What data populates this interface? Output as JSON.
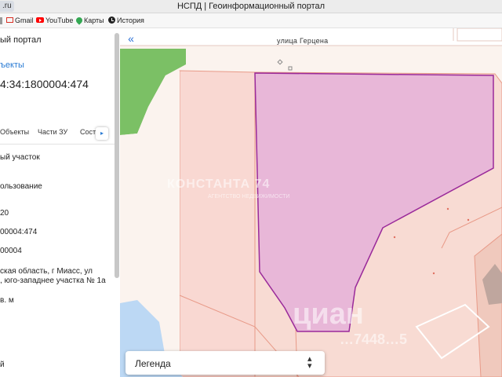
{
  "browser": {
    "url_fragment": ".ru",
    "window_title": "НСПД | Геоинформационный портал",
    "bookmarks": [
      "Gmail",
      "YouTube",
      "Карты",
      "История"
    ]
  },
  "sidebar": {
    "portal_title": "ый портал",
    "objects_link": "ъекты",
    "cadastral_number": "4:34:1800004:474",
    "tabs": [
      "Объекты",
      "Части ЗУ",
      "Сост"
    ],
    "next_tab_label": "▸",
    "fields": [
      "ый участок",
      "ользование",
      "20",
      "00004:474",
      "00004",
      "ская область, г Миасс, ул",
      ", юго-западнее участка № 1а",
      "в. м",
      "й"
    ]
  },
  "map": {
    "collapse_label": "«",
    "street_name": "улица Герцена",
    "watermark_brand": "КОНСТАНТА 74",
    "watermark_sub": "АГЕНТСТВО НЕДВИЖИМОСТИ",
    "watermark_cian": "циан",
    "watermark_phone": "…7448…5",
    "legend_label": "Легенда",
    "legend_chevron": "⌃⌄"
  },
  "colors": {
    "selected_parcel_fill": "#e8b7d8",
    "selected_parcel_stroke": "#9a2a9a",
    "parcel_fill": "#f9d8d2",
    "parcel_stroke": "#e89a88",
    "green_area": "#7bc065",
    "water": "#bcd8f4",
    "link": "#2a7bd4"
  }
}
